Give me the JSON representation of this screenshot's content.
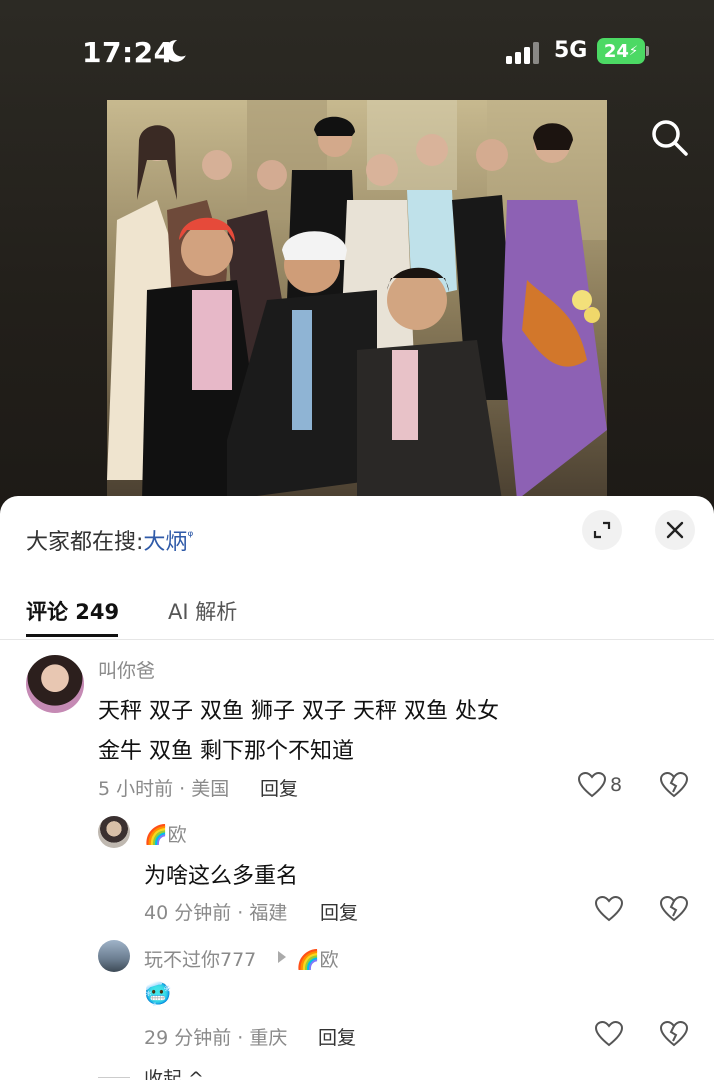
{
  "status_bar": {
    "time": "17:24",
    "network": "5G",
    "battery": "24"
  },
  "hot_search": {
    "prefix": "大家都在搜:",
    "keyword": "大炳",
    "search_glyph": "ᵠ"
  },
  "tabs": {
    "comments": "评论 249",
    "ai": "AI 解析"
  },
  "comments": [
    {
      "user": "叫你爸",
      "lines": [
        "天秤 双子 双鱼 狮子 双子 天秤 双鱼 处女",
        "金牛 双鱼 剩下那个不知道"
      ],
      "meta": "5 小时前 · 美国",
      "reply_label": "回复",
      "likes": "8"
    }
  ],
  "replies": [
    {
      "user": "🌈欧",
      "text": "为啥这么多重名",
      "meta": "40 分钟前 · 福建",
      "reply_label": "回复"
    },
    {
      "user": "玩不过你777",
      "reply_to": "🌈欧",
      "text": "🥶",
      "meta": "29 分钟前 · 重庆",
      "reply_label": "回复"
    }
  ],
  "collapse_label": "收起 ^",
  "colors": {
    "link_blue": "#2f5aa8",
    "battery_green": "#4cd964",
    "muted_gray": "#8a8a8a"
  },
  "icons": [
    "moon-icon",
    "search-icon",
    "expand-icon",
    "close-icon",
    "heart-icon",
    "broken-heart-icon",
    "play-arrow-icon"
  ]
}
